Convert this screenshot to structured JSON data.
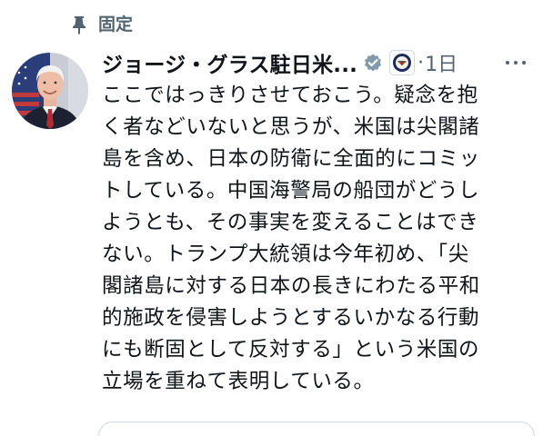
{
  "pinned": {
    "label": "固定",
    "icon": "pin-icon"
  },
  "author": {
    "display_name": "ジョージ・グラス駐日米...",
    "verified_icon": "verified-badge-icon",
    "affiliation_icon": "us-state-department-seal-icon",
    "separator": "·",
    "timestamp": "1日"
  },
  "tweet": {
    "lines": [
      "ここではっきりさせておこう。疑念を抱",
      "く者などいないと思うが、米国は尖閣諸",
      "島を含め、日本の防衛に全面的にコミッ",
      "トしている。中国海警局の船団がどうし",
      "ようとも、その事実を変えることはでき",
      "ない。トランプ大統領は今年初め、「尖",
      "閣諸島に対する日本の長きにわたる平和",
      "的施政を侵害しようとするいかなる行動",
      "にも断固として反対する」という米国の",
      "立場を重ねて表明している。"
    ]
  },
  "colors": {
    "text": "#0f1419",
    "secondary": "#536471",
    "verified_badge": "#829aab",
    "border": "#cfd9de"
  }
}
